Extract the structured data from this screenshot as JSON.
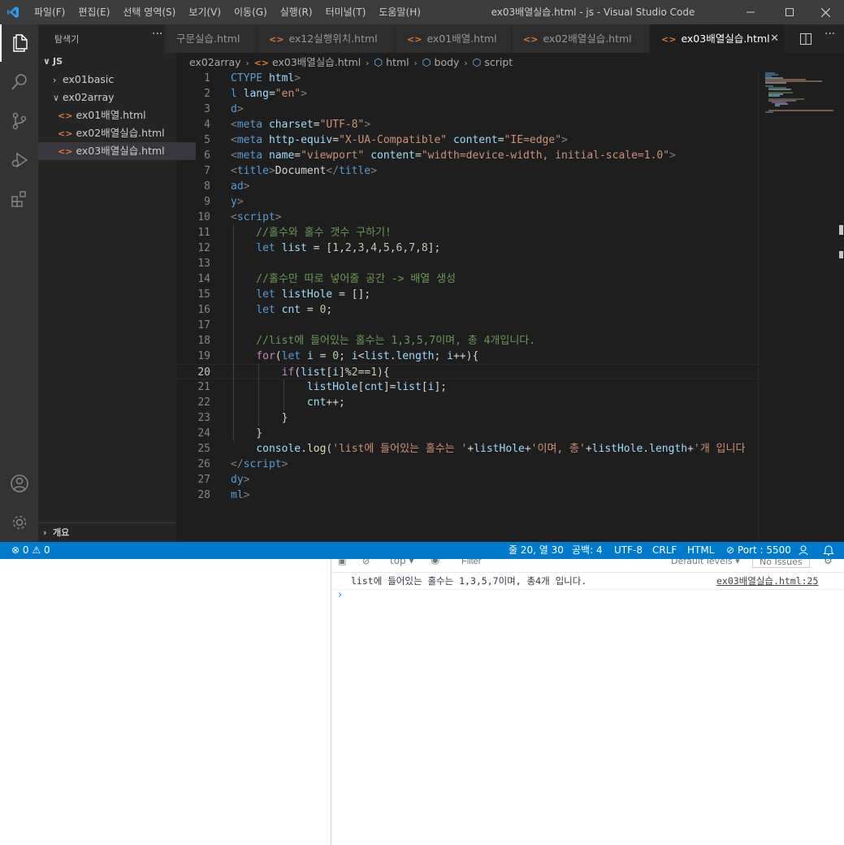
{
  "titlebar": {
    "menus": [
      "파일(F)",
      "편집(E)",
      "선택 영역(S)",
      "보기(V)",
      "이동(G)",
      "실행(R)",
      "터미널(T)",
      "도움말(H)"
    ],
    "title": "ex03배열실습.html - js - Visual Studio Code"
  },
  "sidebar": {
    "header": "탐색기",
    "more": "···",
    "root": "JS",
    "folders": [
      "ex01basic",
      "ex02array"
    ],
    "files": [
      "ex01배열.html",
      "ex02배열실습.html",
      "ex03배열실습.html"
    ],
    "selected_file": "ex03배열실습.html",
    "outline": "개요"
  },
  "tabs": [
    {
      "label": "구문실습.html"
    },
    {
      "label": "ex12실행위치.html"
    },
    {
      "label": "ex01배열.html"
    },
    {
      "label": "ex02배열실습.html"
    },
    {
      "label": "ex03배열실습.html",
      "active": true
    }
  ],
  "breadcrumb": [
    "ex02array",
    "ex03배열실습.html",
    "html",
    "body",
    "script"
  ],
  "editor": {
    "current_line": 20,
    "lines": [
      {
        "n": "1",
        "t": [
          [
            "CTYPE ",
            "#569cd6"
          ],
          [
            "html",
            "#9cdcfe"
          ],
          [
            ">",
            "#808080"
          ]
        ]
      },
      {
        "n": "2",
        "t": [
          [
            "l ",
            "#569cd6"
          ],
          [
            "lang",
            "#9cdcfe"
          ],
          [
            "=",
            "#d4d4d4"
          ],
          [
            "\"en\"",
            "#ce9178"
          ],
          [
            ">",
            "#808080"
          ]
        ]
      },
      {
        "n": "3",
        "t": [
          [
            "d",
            "#569cd6"
          ],
          [
            ">",
            "#808080"
          ]
        ]
      },
      {
        "n": "4",
        "t": [
          [
            "<",
            "#808080"
          ],
          [
            "meta ",
            "#569cd6"
          ],
          [
            "charset",
            "#9cdcfe"
          ],
          [
            "=",
            "#d4d4d4"
          ],
          [
            "\"UTF-8\"",
            "#ce9178"
          ],
          [
            ">",
            "#808080"
          ]
        ]
      },
      {
        "n": "5",
        "t": [
          [
            "<",
            "#808080"
          ],
          [
            "meta ",
            "#569cd6"
          ],
          [
            "http-equiv",
            "#9cdcfe"
          ],
          [
            "=",
            "#d4d4d4"
          ],
          [
            "\"X-UA-Compatible\" ",
            "#ce9178"
          ],
          [
            "content",
            "#9cdcfe"
          ],
          [
            "=",
            "#d4d4d4"
          ],
          [
            "\"IE=edge\"",
            "#ce9178"
          ],
          [
            ">",
            "#808080"
          ]
        ]
      },
      {
        "n": "6",
        "t": [
          [
            "<",
            "#808080"
          ],
          [
            "meta ",
            "#569cd6"
          ],
          [
            "name",
            "#9cdcfe"
          ],
          [
            "=",
            "#d4d4d4"
          ],
          [
            "\"viewport\" ",
            "#ce9178"
          ],
          [
            "content",
            "#9cdcfe"
          ],
          [
            "=",
            "#d4d4d4"
          ],
          [
            "\"width=device-width, initial-scale=1.0\"",
            "#ce9178"
          ],
          [
            ">",
            "#808080"
          ]
        ]
      },
      {
        "n": "7",
        "t": [
          [
            "<",
            "#808080"
          ],
          [
            "title",
            "#569cd6"
          ],
          [
            ">",
            "#808080"
          ],
          [
            "Document",
            "#d4d4d4"
          ],
          [
            "</",
            "#808080"
          ],
          [
            "title",
            "#569cd6"
          ],
          [
            ">",
            "#808080"
          ]
        ]
      },
      {
        "n": "8",
        "t": [
          [
            "ad",
            "#569cd6"
          ],
          [
            ">",
            "#808080"
          ]
        ]
      },
      {
        "n": "9",
        "t": [
          [
            "y",
            "#569cd6"
          ],
          [
            ">",
            "#808080"
          ]
        ]
      },
      {
        "n": "10",
        "t": [
          [
            "<",
            "#808080"
          ],
          [
            "script",
            "#569cd6"
          ],
          [
            ">",
            "#808080"
          ]
        ]
      },
      {
        "n": "11",
        "t": [
          [
            "    //홀수와 홀수 갯수 구하기!",
            "#6a9955"
          ]
        ]
      },
      {
        "n": "12",
        "t": [
          [
            "    ",
            "#d4d4d4"
          ],
          [
            "let ",
            "#569cd6"
          ],
          [
            "list",
            "#9cdcfe"
          ],
          [
            " = [",
            "#d4d4d4"
          ],
          [
            "1",
            "#b5cea8"
          ],
          [
            ",",
            "#d4d4d4"
          ],
          [
            "2",
            "#b5cea8"
          ],
          [
            ",",
            "#d4d4d4"
          ],
          [
            "3",
            "#b5cea8"
          ],
          [
            ",",
            "#d4d4d4"
          ],
          [
            "4",
            "#b5cea8"
          ],
          [
            ",",
            "#d4d4d4"
          ],
          [
            "5",
            "#b5cea8"
          ],
          [
            ",",
            "#d4d4d4"
          ],
          [
            "6",
            "#b5cea8"
          ],
          [
            ",",
            "#d4d4d4"
          ],
          [
            "7",
            "#b5cea8"
          ],
          [
            ",",
            "#d4d4d4"
          ],
          [
            "8",
            "#b5cea8"
          ],
          [
            "];",
            "#d4d4d4"
          ]
        ]
      },
      {
        "n": "13",
        "t": []
      },
      {
        "n": "14",
        "t": [
          [
            "    //홀수만 따로 넣어줄 공간 -> 배열 생성",
            "#6a9955"
          ]
        ]
      },
      {
        "n": "15",
        "t": [
          [
            "    ",
            "#d4d4d4"
          ],
          [
            "let ",
            "#569cd6"
          ],
          [
            "listHole",
            "#9cdcfe"
          ],
          [
            " = [];",
            "#d4d4d4"
          ]
        ]
      },
      {
        "n": "16",
        "t": [
          [
            "    ",
            "#d4d4d4"
          ],
          [
            "let ",
            "#569cd6"
          ],
          [
            "cnt",
            "#9cdcfe"
          ],
          [
            " = ",
            "#d4d4d4"
          ],
          [
            "0",
            "#b5cea8"
          ],
          [
            ";",
            "#d4d4d4"
          ]
        ]
      },
      {
        "n": "17",
        "t": []
      },
      {
        "n": "18",
        "t": [
          [
            "    //list에 들어있는 홀수는 1,3,5,7이며, 총 4개입니다.",
            "#6a9955"
          ]
        ]
      },
      {
        "n": "19",
        "t": [
          [
            "    ",
            "#d4d4d4"
          ],
          [
            "for",
            "#c586c0"
          ],
          [
            "(",
            "#d4d4d4"
          ],
          [
            "let ",
            "#569cd6"
          ],
          [
            "i",
            "#9cdcfe"
          ],
          [
            " = ",
            "#d4d4d4"
          ],
          [
            "0",
            "#b5cea8"
          ],
          [
            "; ",
            "#d4d4d4"
          ],
          [
            "i",
            "#9cdcfe"
          ],
          [
            "<",
            "#d4d4d4"
          ],
          [
            "list",
            "#9cdcfe"
          ],
          [
            ".",
            "#d4d4d4"
          ],
          [
            "length",
            "#9cdcfe"
          ],
          [
            "; ",
            "#d4d4d4"
          ],
          [
            "i",
            "#9cdcfe"
          ],
          [
            "++){",
            "#d4d4d4"
          ]
        ]
      },
      {
        "n": "20",
        "t": [
          [
            "        ",
            "#d4d4d4"
          ],
          [
            "if",
            "#c586c0"
          ],
          [
            "(",
            "#d4d4d4"
          ],
          [
            "list",
            "#9cdcfe"
          ],
          [
            "[",
            "#d4d4d4"
          ],
          [
            "i",
            "#9cdcfe"
          ],
          [
            "]%",
            "#d4d4d4"
          ],
          [
            "2",
            "#b5cea8"
          ],
          [
            "==",
            "#d4d4d4"
          ],
          [
            "1",
            "#b5cea8"
          ],
          [
            "){",
            "#d4d4d4"
          ]
        ]
      },
      {
        "n": "21",
        "t": [
          [
            "            ",
            "#d4d4d4"
          ],
          [
            "listHole",
            "#9cdcfe"
          ],
          [
            "[",
            "#d4d4d4"
          ],
          [
            "cnt",
            "#9cdcfe"
          ],
          [
            "]=",
            "#d4d4d4"
          ],
          [
            "list",
            "#9cdcfe"
          ],
          [
            "[",
            "#d4d4d4"
          ],
          [
            "i",
            "#9cdcfe"
          ],
          [
            "];",
            "#d4d4d4"
          ]
        ]
      },
      {
        "n": "22",
        "t": [
          [
            "            ",
            "#d4d4d4"
          ],
          [
            "cnt",
            "#9cdcfe"
          ],
          [
            "++;",
            "#d4d4d4"
          ]
        ]
      },
      {
        "n": "23",
        "t": [
          [
            "        }",
            "#d4d4d4"
          ]
        ]
      },
      {
        "n": "24",
        "t": [
          [
            "    }",
            "#d4d4d4"
          ]
        ]
      },
      {
        "n": "25",
        "t": [
          [
            "    ",
            "#d4d4d4"
          ],
          [
            "console",
            "#9cdcfe"
          ],
          [
            ".",
            "#d4d4d4"
          ],
          [
            "log",
            "#dcdcaa"
          ],
          [
            "(",
            "#d4d4d4"
          ],
          [
            "'list에 들어있는 홀수는 '",
            "#ce9178"
          ],
          [
            "+",
            "#d4d4d4"
          ],
          [
            "listHole",
            "#9cdcfe"
          ],
          [
            "+",
            "#d4d4d4"
          ],
          [
            "'이며, 총'",
            "#ce9178"
          ],
          [
            "+",
            "#d4d4d4"
          ],
          [
            "listHole",
            "#9cdcfe"
          ],
          [
            ".",
            "#d4d4d4"
          ],
          [
            "length",
            "#9cdcfe"
          ],
          [
            "+",
            "#d4d4d4"
          ],
          [
            "'개 입니다",
            "#ce9178"
          ]
        ]
      },
      {
        "n": "26",
        "t": [
          [
            "</",
            "#808080"
          ],
          [
            "script",
            "#569cd6"
          ],
          [
            ">",
            "#808080"
          ]
        ]
      },
      {
        "n": "27",
        "t": [
          [
            "dy",
            "#569cd6"
          ],
          [
            ">",
            "#808080"
          ]
        ]
      },
      {
        "n": "28",
        "t": [
          [
            "ml",
            "#569cd6"
          ],
          [
            ">",
            "#808080"
          ]
        ]
      }
    ]
  },
  "statusbar": {
    "errors": "0",
    "warnings": "0",
    "position": "줄 20, 열 30",
    "spaces": "공백: 4",
    "encoding": "UTF-8",
    "eol": "CRLF",
    "language": "HTML",
    "port": "Port : 5500"
  },
  "devtools": {
    "context": "top",
    "filter_placeholder": "Filter",
    "levels": "Default levels",
    "issues": "No Issues",
    "log_message": "list에 들어있는 홀수는 1,3,5,7이며, 총4개 입니다.",
    "log_source": "ex03배열실습.html:25",
    "prompt": "›"
  },
  "colors": {
    "accent_status": "#007acc",
    "editor_bg": "#1e1e1e",
    "sidebar_bg": "#252526",
    "activity_bg": "#333333",
    "titlebar_bg": "#3c3c3c",
    "html_icon": "#e37933"
  }
}
